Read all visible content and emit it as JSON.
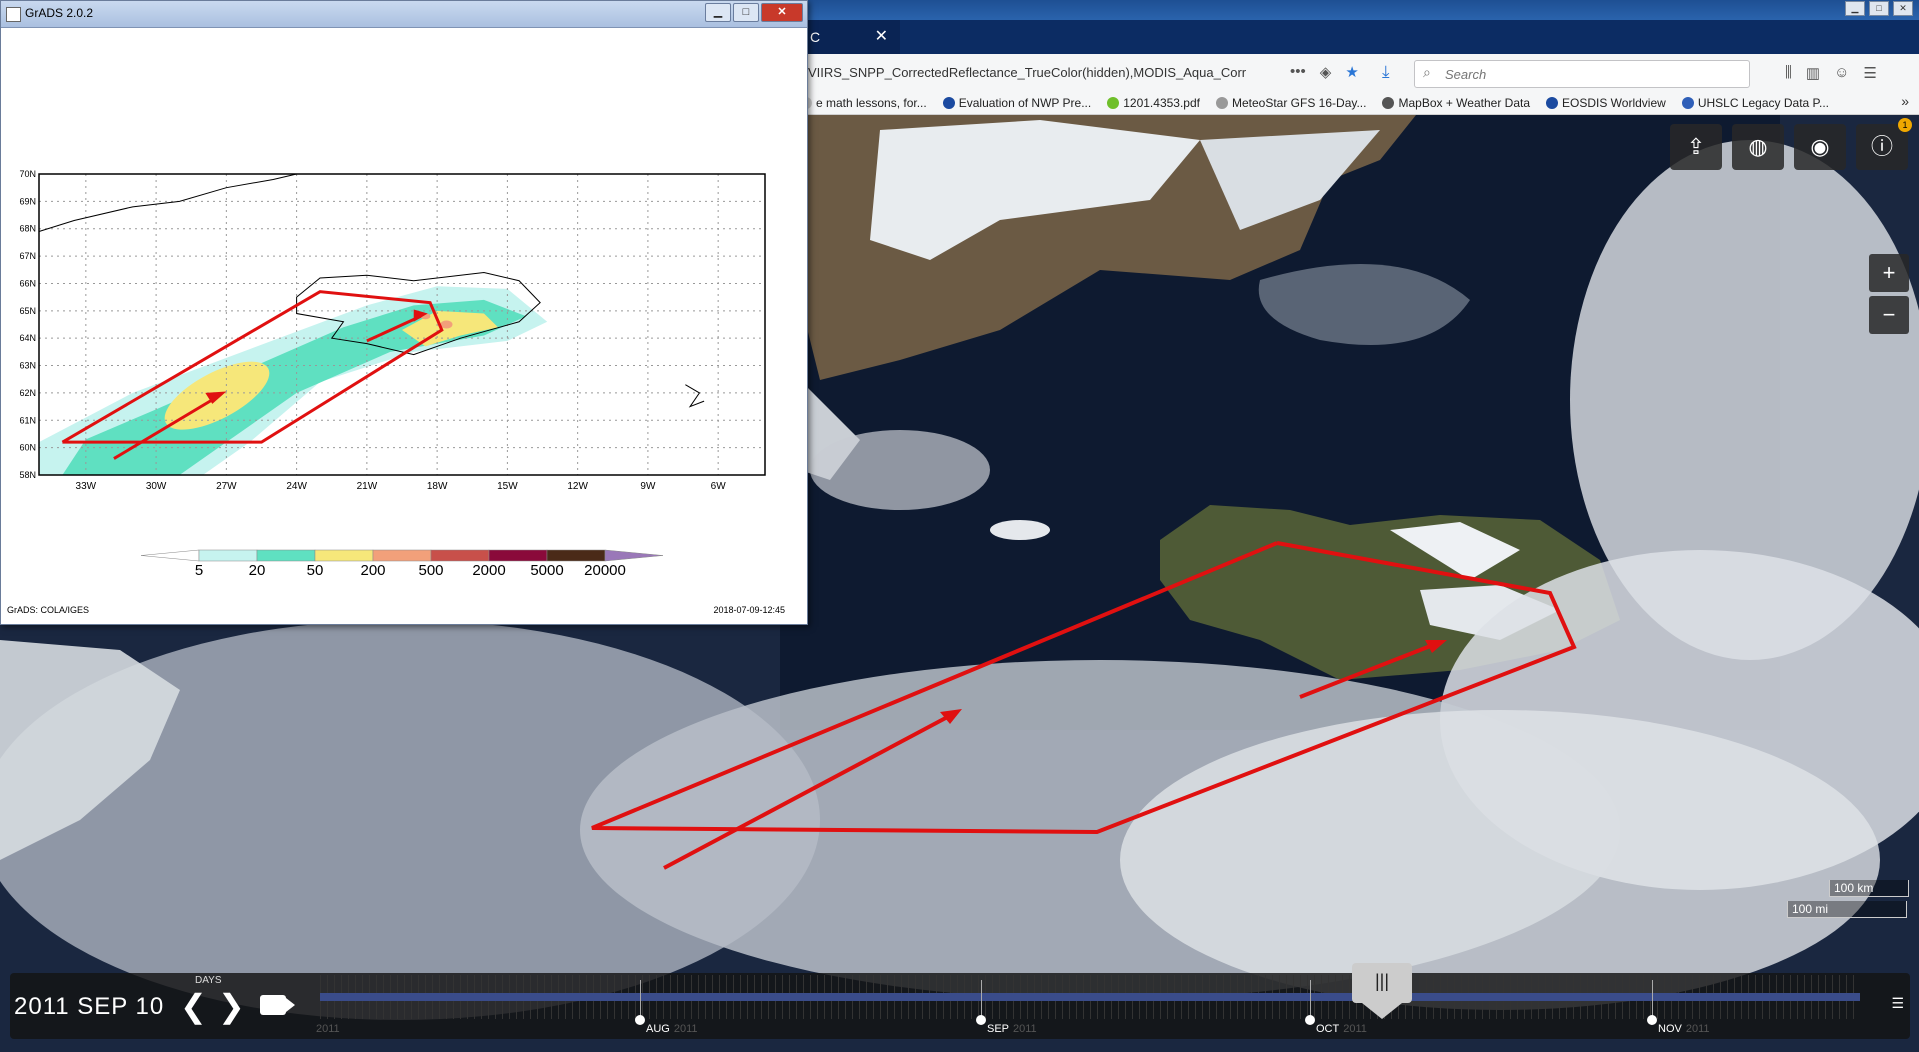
{
  "browser": {
    "tab_partial_label": "C",
    "tab_close": "✕",
    "url": "VIIRS_SNPP_CorrectedReflectance_TrueColor(hidden),MODIS_Aqua_Corr",
    "search_placeholder": "Search",
    "bookmarks": [
      {
        "label": "e math lessons, for...",
        "icon_color": "#cfcfcf"
      },
      {
        "label": "Evaluation of NWP Pre...",
        "icon_color": "#1b4aa0"
      },
      {
        "label": "1201.4353.pdf",
        "icon_color": "#6fbf2a"
      },
      {
        "label": "MeteoStar GFS 16-Day...",
        "icon_color": "#999999"
      },
      {
        "label": "MapBox + Weather Data",
        "icon_color": "#555555"
      },
      {
        "label": "EOSDIS Worldview",
        "icon_color": "#1b4aa0"
      },
      {
        "label": "UHSLC Legacy Data P...",
        "icon_color": "#2f5fb8"
      }
    ]
  },
  "worldview": {
    "notification_count": "1",
    "zoom_in": "+",
    "zoom_out": "−",
    "scale_km": "100 km",
    "scale_mi": "100 mi"
  },
  "timeline": {
    "date": "2011 SEP 10",
    "interval": "DAYS",
    "months": [
      {
        "name": "AUG",
        "year": "2011"
      },
      {
        "name": "SEP",
        "year": "2011"
      },
      {
        "name": "OCT",
        "year": "2011"
      },
      {
        "name": "NOV",
        "year": "2011"
      }
    ],
    "prev_year": "2011",
    "handle": "|||"
  },
  "grads": {
    "title": "GrADS 2.0.2",
    "footer_left": "GrADS: COLA/IGES",
    "footer_right": "2018-07-09-12:45"
  },
  "chart_data": {
    "type": "heatmap",
    "xticks": [
      "33W",
      "30W",
      "27W",
      "24W",
      "21W",
      "18W",
      "15W",
      "12W",
      "9W",
      "6W"
    ],
    "yticks": [
      "58N",
      "60N",
      "61N",
      "62N",
      "63N",
      "64N",
      "65N",
      "66N",
      "67N",
      "68N",
      "69N",
      "70N"
    ],
    "xlim": [
      -35,
      -4
    ],
    "ylim": [
      59,
      70
    ],
    "grid": true,
    "colorbar_levels": [
      "5",
      "20",
      "50",
      "200",
      "500",
      "2000",
      "5000",
      "20000"
    ],
    "colorbar_colors": [
      "#ffffff",
      "#c6f3ef",
      "#5fe0c1",
      "#f6e77a",
      "#f2a07a",
      "#c8504a",
      "#8a0a3a",
      "#4a2a18",
      "#9a78b8"
    ]
  }
}
